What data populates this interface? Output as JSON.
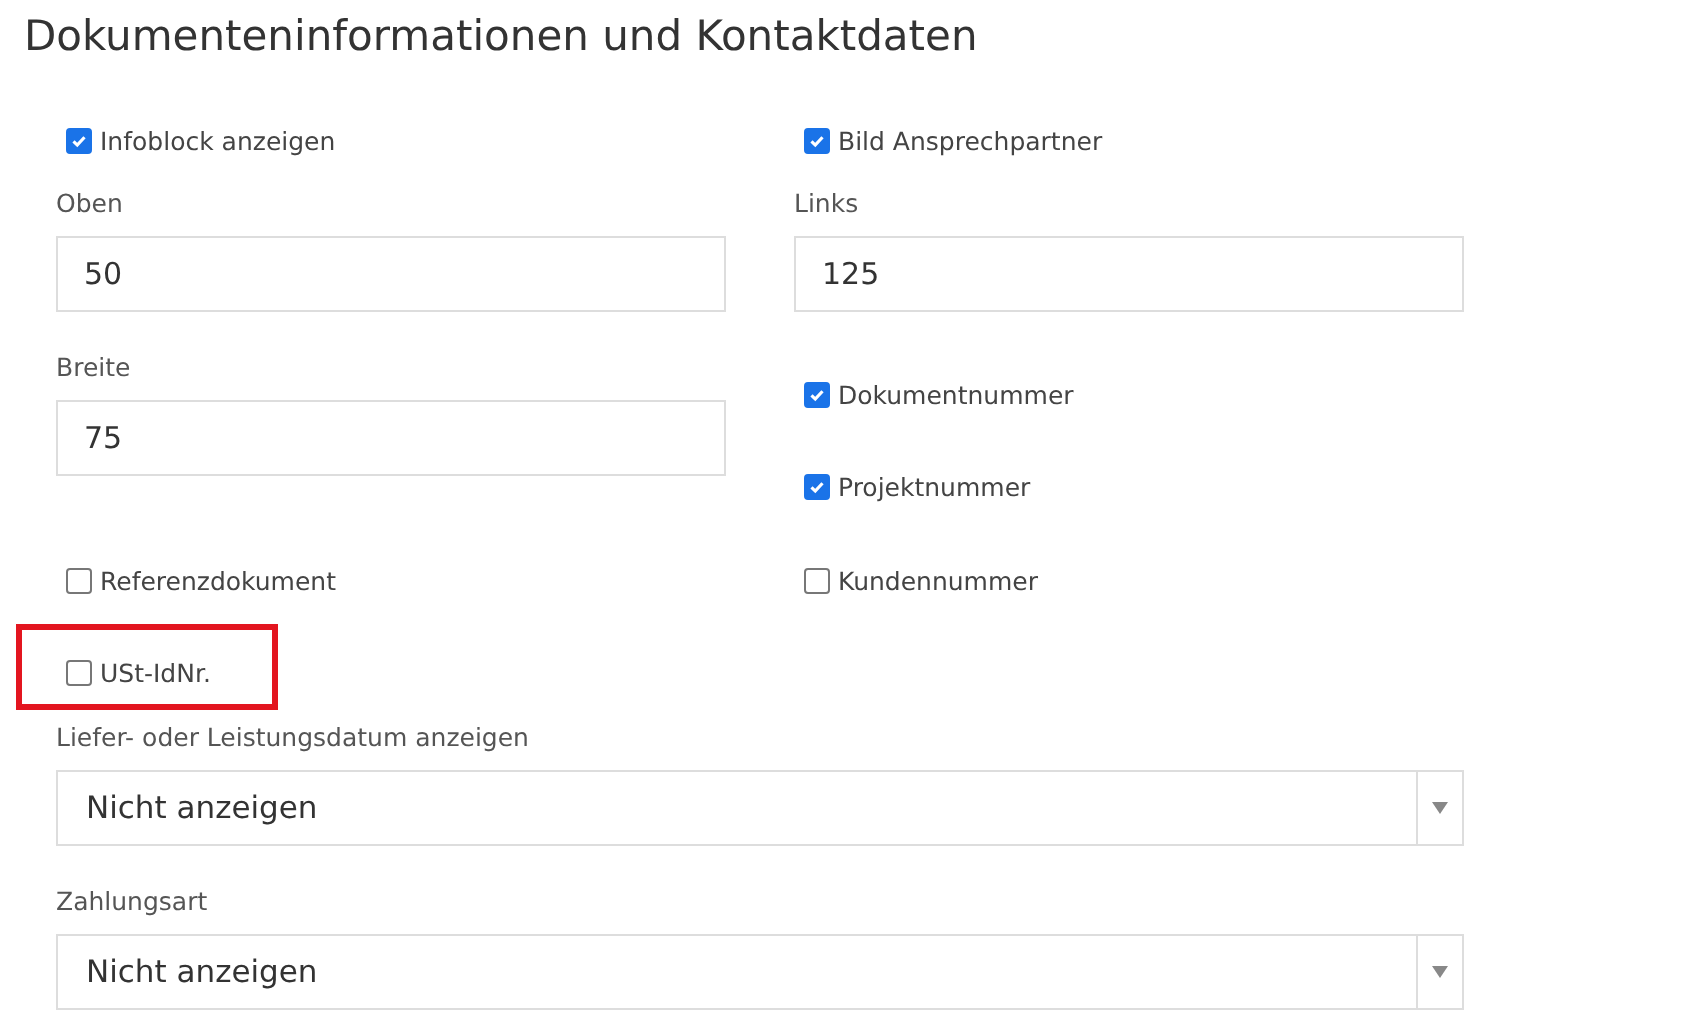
{
  "title": "Dokumenteninformationen und Kontaktdaten",
  "rows": [
    {
      "cells": [
        {
          "kind": "checkbox",
          "label": "Infoblock anzeigen",
          "checked": true
        },
        {
          "kind": "checkbox",
          "label": "Bild Ansprechpartner",
          "checked": true
        }
      ]
    },
    {
      "cells": [
        {
          "kind": "input",
          "label": "Oben",
          "value": "50"
        },
        {
          "kind": "input",
          "label": "Links",
          "value": "125"
        }
      ]
    },
    {
      "cells": [
        {
          "kind": "input",
          "label": "Breite",
          "value": "75"
        },
        {
          "kind": "stack",
          "items": [
            {
              "kind": "checkbox",
              "label": "Dokumentnummer",
              "checked": true
            },
            {
              "kind": "checkbox",
              "label": "Projektnummer",
              "checked": true
            }
          ]
        }
      ]
    },
    {
      "cells": [
        {
          "kind": "checkbox",
          "label": "Referenzdokument",
          "checked": false
        },
        {
          "kind": "checkbox",
          "label": "Kundennummer",
          "checked": false
        }
      ]
    },
    {
      "cells": [
        {
          "kind": "checkbox",
          "label": "USt-IdNr.",
          "checked": false,
          "highlighted": true
        }
      ]
    },
    {
      "cells": [
        {
          "kind": "select",
          "label": "Liefer- oder Leistungsdatum anzeigen",
          "value": "Nicht anzeigen"
        }
      ]
    },
    {
      "cells": [
        {
          "kind": "select",
          "label": "Zahlungsart",
          "value": "Nicht anzeigen"
        }
      ]
    }
  ]
}
